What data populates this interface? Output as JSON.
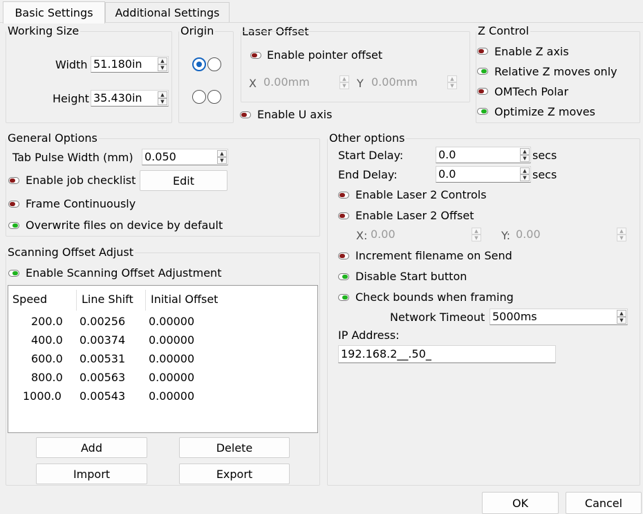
{
  "tabs": [
    {
      "label": "Basic Settings",
      "active": true
    },
    {
      "label": "Additional Settings",
      "active": false
    }
  ],
  "working_size": {
    "title": "Working Size",
    "width_label": "Width",
    "width_value": "51.180in",
    "height_label": "Height",
    "height_value": "35.430in"
  },
  "origin": {
    "title": "Origin",
    "selected": "top-left"
  },
  "laser_offset": {
    "title": "Laser Offset",
    "enable_pointer": {
      "label": "Enable pointer offset",
      "on": false
    },
    "x_label": "X",
    "x_value": "0.00mm",
    "y_label": "Y",
    "y_value": "0.00mm",
    "enable_u": {
      "label": "Enable U axis",
      "on": false
    }
  },
  "z_control": {
    "title": "Z Control",
    "items": [
      {
        "label": "Enable Z axis",
        "on": false
      },
      {
        "label": "Relative Z moves only",
        "on": true
      },
      {
        "label": "OMTech Polar",
        "on": false
      },
      {
        "label": "Optimize Z moves",
        "on": true
      }
    ]
  },
  "general_options": {
    "title": "General Options",
    "tab_pulse_label": "Tab Pulse Width (mm)",
    "tab_pulse_value": "0.050",
    "job_checklist": {
      "label": "Enable job checklist",
      "on": false
    },
    "edit_label": "Edit",
    "frame_continuously": {
      "label": "Frame Continuously",
      "on": false
    },
    "overwrite_files": {
      "label": "Overwrite files on device by default",
      "on": true
    }
  },
  "scanning": {
    "title": "Scanning Offset Adjust",
    "enable": {
      "label": "Enable Scanning Offset Adjustment",
      "on": true
    },
    "headers": [
      "Speed",
      "Line Shift",
      "Initial Offset"
    ],
    "rows": [
      [
        "200.0",
        "0.00256",
        "0.00000"
      ],
      [
        "400.0",
        "0.00374",
        "0.00000"
      ],
      [
        "600.0",
        "0.00531",
        "0.00000"
      ],
      [
        "800.0",
        "0.00563",
        "0.00000"
      ],
      [
        "1000.0",
        "0.00543",
        "0.00000"
      ]
    ],
    "add_label": "Add",
    "delete_label": "Delete",
    "import_label": "Import",
    "export_label": "Export"
  },
  "other_options": {
    "title": "Other options",
    "start_delay_label": "Start Delay:",
    "start_delay_value": "0.0",
    "end_delay_label": "End Delay:",
    "end_delay_value": "0.0",
    "secs": "secs",
    "laser2_controls": {
      "label": "Enable Laser 2 Controls",
      "on": false
    },
    "laser2_offset": {
      "label": "Enable Laser 2 Offset",
      "on": false
    },
    "x_label": "X:",
    "x_value": "0.00",
    "y_label": "Y:",
    "y_value": "0.00",
    "increment_filename": {
      "label": "Increment filename on Send",
      "on": false
    },
    "disable_start": {
      "label": "Disable Start button",
      "on": true
    },
    "check_bounds": {
      "label": "Check bounds when framing",
      "on": true
    },
    "network_timeout_label": "Network Timeout",
    "network_timeout_value": "5000ms",
    "ip_label": "IP Address:",
    "ip_value": "192.168.2__.50_"
  },
  "dialog": {
    "ok_label": "OK",
    "cancel_label": "Cancel"
  }
}
